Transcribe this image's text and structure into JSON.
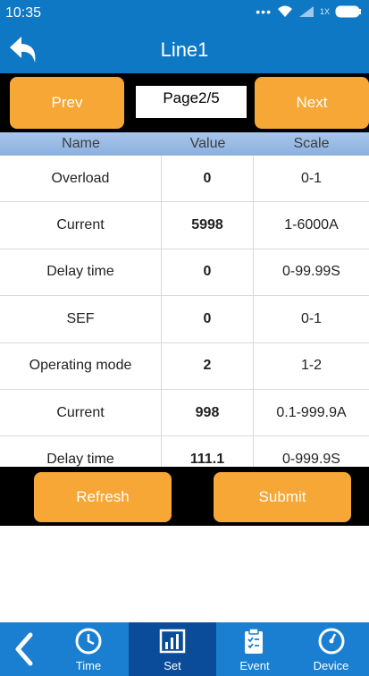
{
  "status": {
    "time": "10:35",
    "battery_label": "1X"
  },
  "header": {
    "title": "Line1"
  },
  "pager": {
    "prev_label": "Prev",
    "next_label": "Next",
    "page_text": "Page2/5"
  },
  "table": {
    "headers": [
      "Name",
      "Value",
      "Scale"
    ],
    "rows": [
      {
        "name": "Overload",
        "value": "0",
        "scale": "0-1"
      },
      {
        "name": "Current",
        "value": "5998",
        "scale": "1-6000A"
      },
      {
        "name": "Delay time",
        "value": "0",
        "scale": "0-99.99S"
      },
      {
        "name": "SEF",
        "value": "0",
        "scale": "0-1"
      },
      {
        "name": "Operating mode",
        "value": "2",
        "scale": "1-2"
      },
      {
        "name": "Current",
        "value": "998",
        "scale": "0.1-999.9A"
      },
      {
        "name": "Delay time",
        "value": "111.1",
        "scale": "0-999.9S"
      }
    ]
  },
  "actions": {
    "refresh_label": "Refresh",
    "submit_label": "Submit"
  },
  "bottom_nav": {
    "items": [
      {
        "label": "Time",
        "icon": "clock-icon"
      },
      {
        "label": "Set",
        "icon": "chart-icon",
        "active": true
      },
      {
        "label": "Event",
        "icon": "clipboard-icon"
      },
      {
        "label": "Device",
        "icon": "gauge-icon"
      }
    ]
  },
  "colors": {
    "header_blue": "#0f78c4",
    "button_orange": "#f6a735",
    "nav_blue": "#1a7fd0",
    "nav_active": "#0a4c99"
  }
}
